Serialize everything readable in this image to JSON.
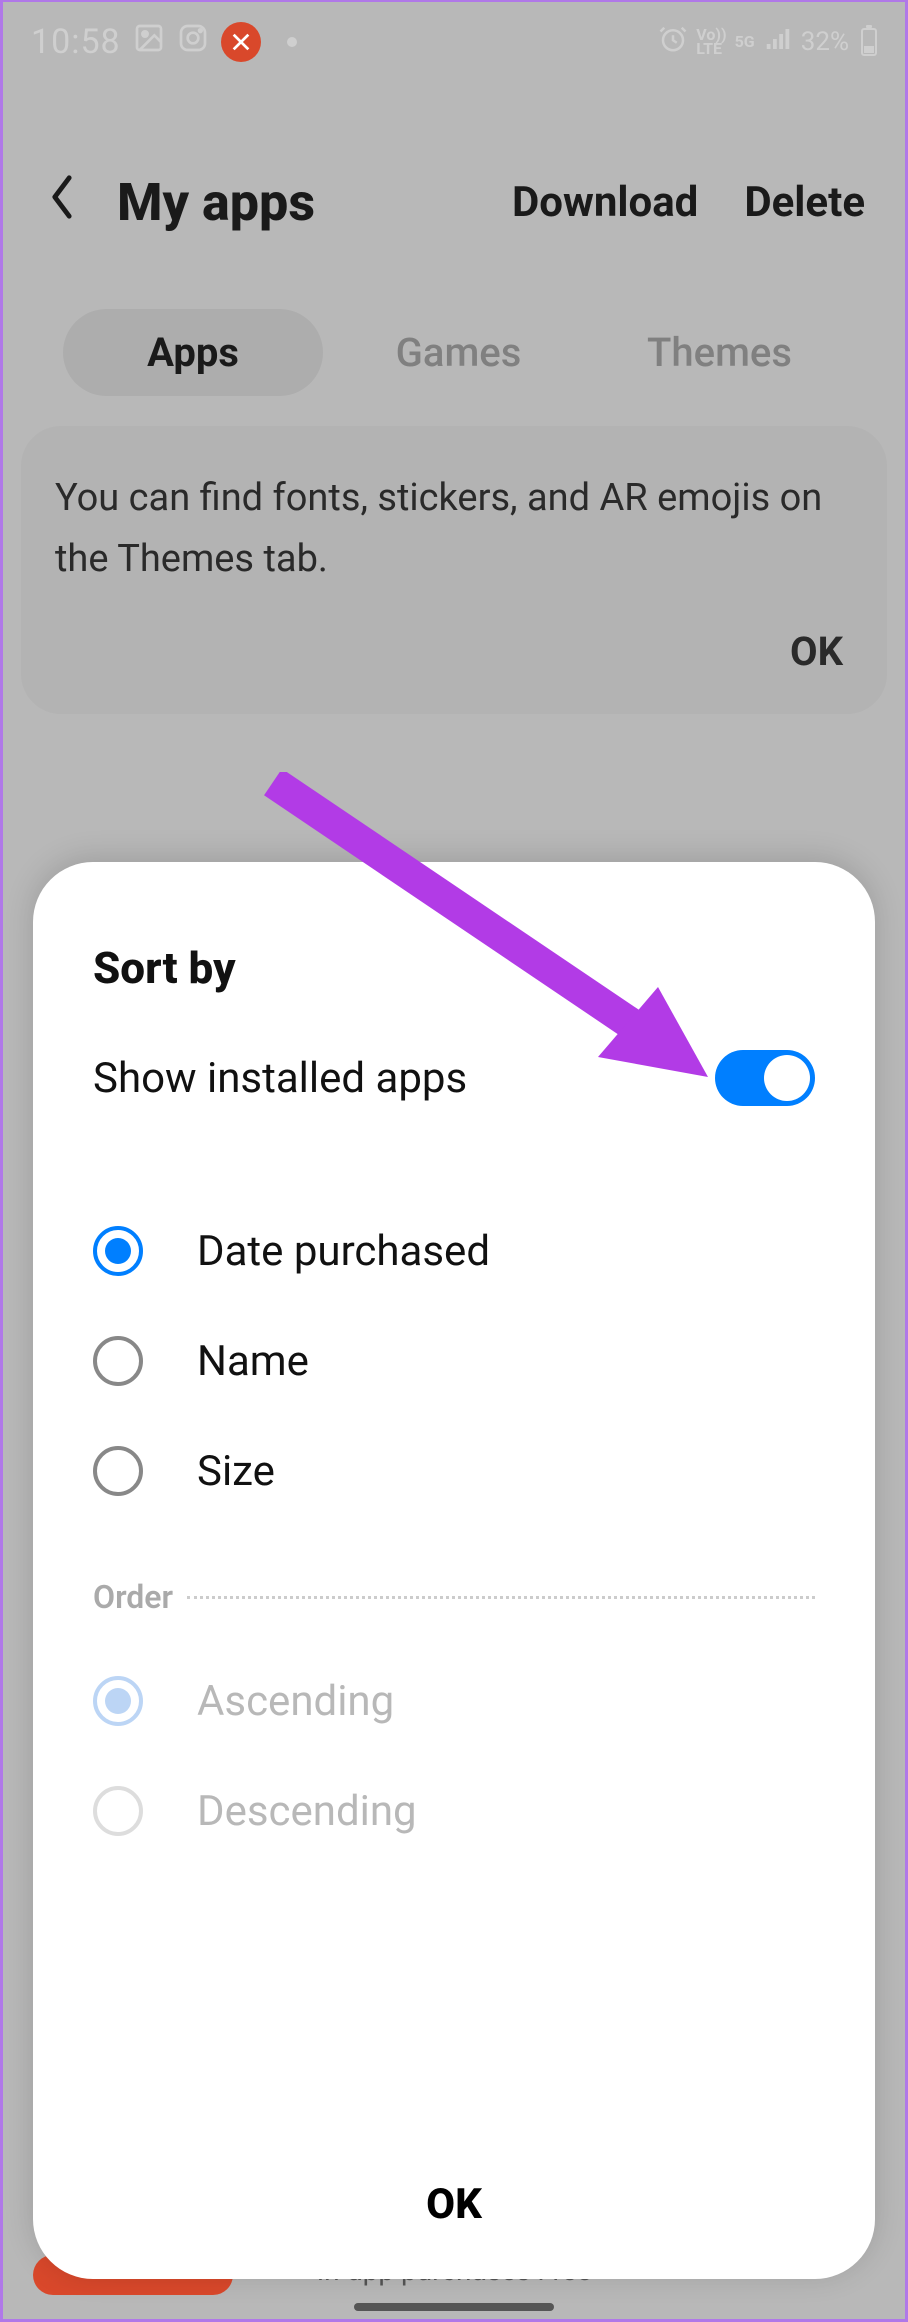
{
  "status": {
    "time": "10:58",
    "icons": {
      "gallery": "gallery-icon",
      "instagram": "instagram-icon",
      "dnd": "dnd-icon"
    },
    "alarm": true,
    "volte": "Vo))\nLTE",
    "network": "5G",
    "signal": "signal-icon",
    "battery_pct": "32%"
  },
  "header": {
    "title": "My apps",
    "download": "Download",
    "delete": "Delete"
  },
  "tabs": {
    "apps": "Apps",
    "games": "Games",
    "themes": "Themes",
    "active": "apps"
  },
  "info": {
    "message": "You can find fonts, stickers, and AR emojis on the Themes tab.",
    "ok": "OK"
  },
  "modal": {
    "title": "Sort by",
    "toggle_label": "Show installed apps",
    "toggle_on": true,
    "sort_options": {
      "date": "Date purchased",
      "name": "Name",
      "size": "Size",
      "selected": "date"
    },
    "order_label": "Order",
    "order_options": {
      "asc": "Ascending",
      "desc": "Descending",
      "selected": "asc"
    },
    "ok": "OK"
  },
  "peek": {
    "text": "In-app purchases Free"
  },
  "annotation": {
    "arrow_color": "#b23be6"
  }
}
